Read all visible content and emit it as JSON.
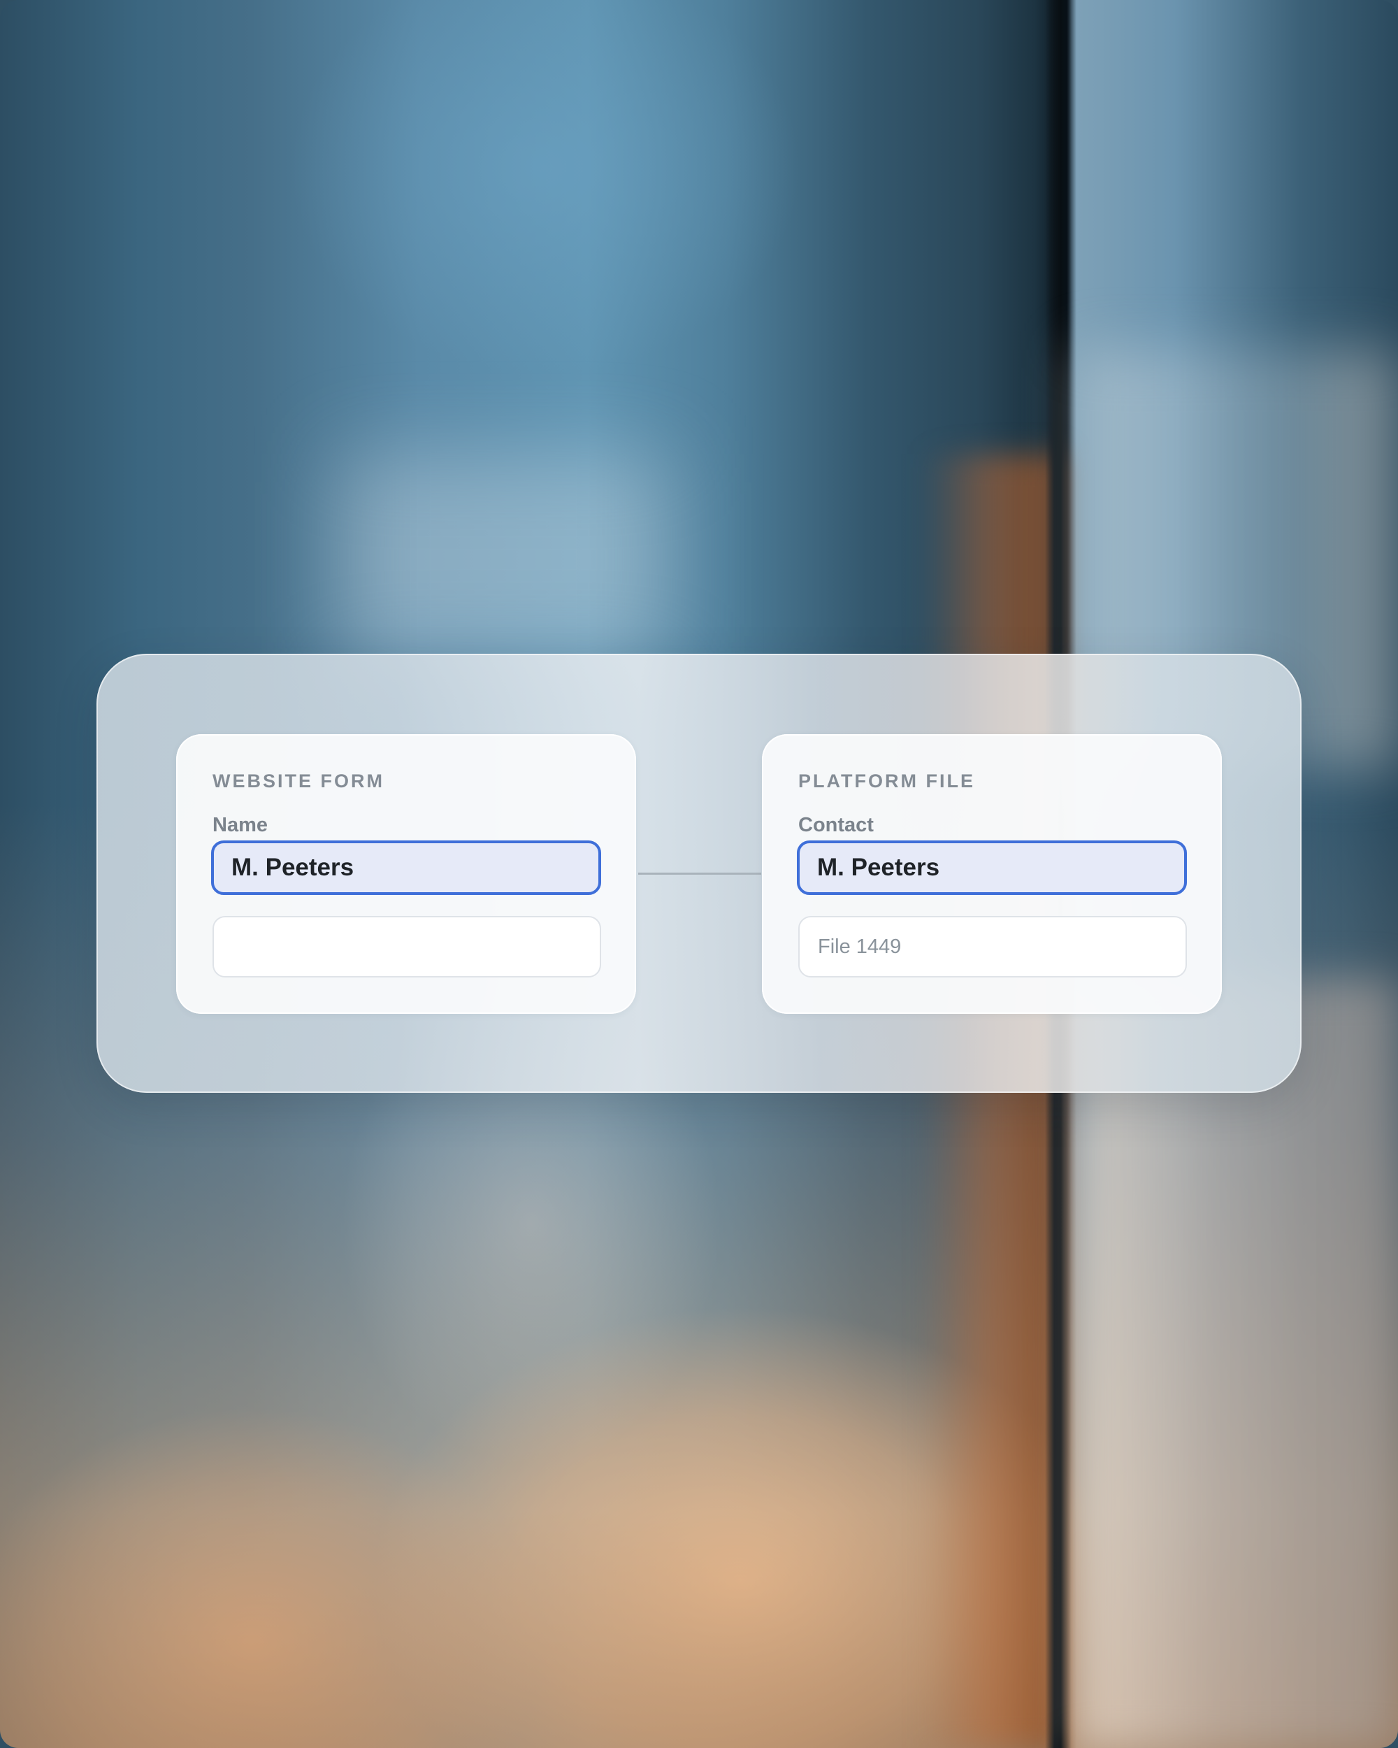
{
  "left_card": {
    "title": "WEBSITE FORM",
    "field_label": "Name",
    "field_value": "M. Peeters",
    "second_field_value": ""
  },
  "right_card": {
    "title": "PLATFORM FILE",
    "field_label": "Contact",
    "field_value": "M. Peeters",
    "second_field_value": "File 1449"
  },
  "colors": {
    "focus_border": "#3f6fd9",
    "focus_fill": "#e6eaf8",
    "label_gray": "#848c95",
    "value_text": "#1f2328"
  }
}
